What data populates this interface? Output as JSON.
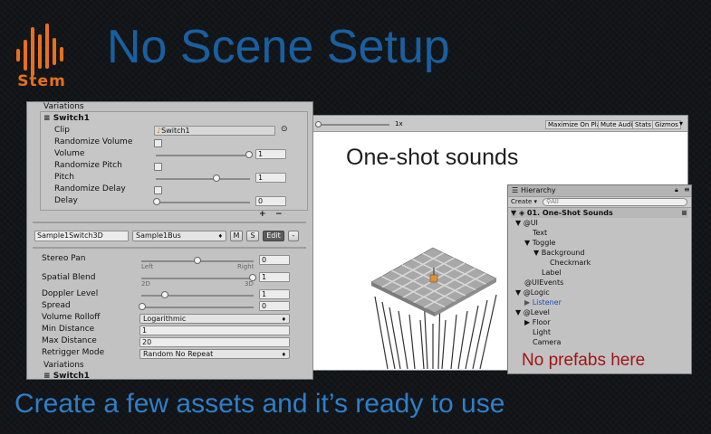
{
  "logo": {
    "word": "Stem"
  },
  "title": "No Scene Setup",
  "caption": "Create a few assets and it’s ready to use",
  "inspector": {
    "variations_label": "Variations",
    "switch_name": "Switch1",
    "clip": {
      "label": "Clip",
      "value": "Switch1"
    },
    "randomize_volume": {
      "label": "Randomize Volume",
      "checked": false
    },
    "volume": {
      "label": "Volume",
      "value": "1",
      "level": 1.0
    },
    "randomize_pitch": {
      "label": "Randomize Pitch",
      "checked": false
    },
    "pitch": {
      "label": "Pitch",
      "value": "1",
      "level": 0.6
    },
    "randomize_delay": {
      "label": "Randomize Delay",
      "checked": false
    },
    "delay": {
      "label": "Delay",
      "value": "0",
      "level": 0.0
    },
    "add_label": "+",
    "remove_label": "−",
    "bank_name": "Sample1Switch3D",
    "bus_select": "Sample1Bus",
    "m_label": "M",
    "s_label": "S",
    "edit_label": "Edit",
    "minus_label": "-",
    "stereo_pan": {
      "label": "Stereo Pan",
      "value": "0",
      "left": "Left",
      "right": "Right",
      "level": 0.5
    },
    "spatial_blend": {
      "label": "Spatial Blend",
      "value": "1",
      "left": "2D",
      "right": "3D",
      "level": 1.0
    },
    "doppler": {
      "label": "Doppler Level",
      "value": "1",
      "level": 0.2
    },
    "spread": {
      "label": "Spread",
      "value": "0",
      "level": 0.0
    },
    "rolloff": {
      "label": "Volume Rolloff",
      "value": "Logarithmic"
    },
    "min_distance": {
      "label": "Min Distance",
      "value": "1"
    },
    "max_distance": {
      "label": "Max Distance",
      "value": "20"
    },
    "retrigger": {
      "label": "Retrigger Mode",
      "value": "Random No Repeat"
    },
    "variations2_label": "Variations",
    "switch2_name": "Switch1"
  },
  "game": {
    "scale_label": "1x",
    "maximize": "Maximize On Play",
    "mute": "Mute Audio",
    "stats": "Stats",
    "gizmos": "Gizmos",
    "heading": "One-shot sounds"
  },
  "hierarchy": {
    "tab": "Hierarchy",
    "create": "Create",
    "search_placeholder": "All",
    "scene": "01. One-Shot Sounds",
    "rows": [
      "@UI",
      "Text",
      "Toggle",
      "Background",
      "Checkmark",
      "Label",
      "@UIEvents",
      "@Logic",
      "Listener",
      "@Level",
      "Floor",
      "Light",
      "Camera"
    ]
  },
  "note": "No prefabs here",
  "colors": {
    "accent": "#e8701c",
    "title_blue": "#1a5fa0",
    "caption_blue": "#2f7ec8",
    "note_red": "#a01418",
    "prefab_blue": "#1f4fb0"
  }
}
